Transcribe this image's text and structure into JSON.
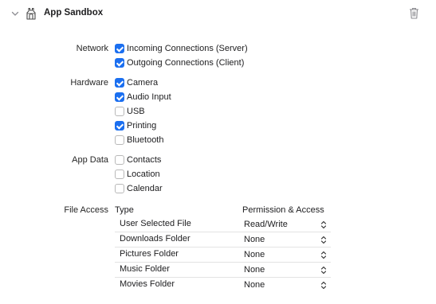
{
  "header": {
    "title": "App Sandbox",
    "expand_icon": "chevron-down-icon",
    "capability_icon": "sandbox-icon",
    "delete_icon": "trash-icon"
  },
  "network": {
    "label": "Network",
    "options": [
      {
        "label": "Incoming Connections (Server)",
        "checked": true
      },
      {
        "label": "Outgoing Connections (Client)",
        "checked": true
      }
    ]
  },
  "hardware": {
    "label": "Hardware",
    "options": [
      {
        "label": "Camera",
        "checked": true
      },
      {
        "label": "Audio Input",
        "checked": true
      },
      {
        "label": "USB",
        "checked": false
      },
      {
        "label": "Printing",
        "checked": true
      },
      {
        "label": "Bluetooth",
        "checked": false
      }
    ]
  },
  "app_data": {
    "label": "App Data",
    "options": [
      {
        "label": "Contacts",
        "checked": false
      },
      {
        "label": "Location",
        "checked": false
      },
      {
        "label": "Calendar",
        "checked": false
      }
    ]
  },
  "file_access": {
    "label": "File Access",
    "col_type": "Type",
    "col_permission": "Permission & Access",
    "rows": [
      {
        "type": "User Selected File",
        "permission": "Read/Write"
      },
      {
        "type": "Downloads Folder",
        "permission": "None"
      },
      {
        "type": "Pictures Folder",
        "permission": "None"
      },
      {
        "type": "Music Folder",
        "permission": "None"
      },
      {
        "type": "Movies Folder",
        "permission": "None"
      }
    ]
  },
  "colors": {
    "accent": "#1b6ff0"
  }
}
